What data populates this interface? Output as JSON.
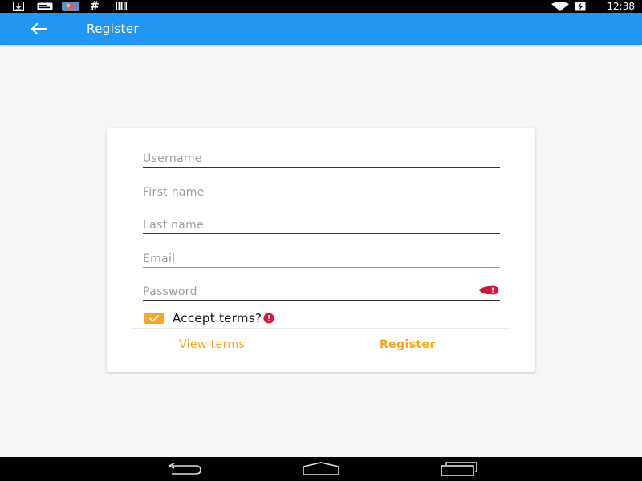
{
  "status_bar": {
    "time": "12:38",
    "icons": [
      "download-icon",
      "message-icon",
      "photo-icon",
      "hash-icon",
      "barcode-icon",
      "wifi-icon",
      "battery-charging-icon"
    ],
    "hash_glyph": "#"
  },
  "app_bar": {
    "title": "Register",
    "back_icon": "arrow-left-icon",
    "color": "#2196f3"
  },
  "form": {
    "username": {
      "placeholder": "Username",
      "value": ""
    },
    "first_name": {
      "placeholder": "First name",
      "value": ""
    },
    "last_name": {
      "placeholder": "Last name",
      "value": ""
    },
    "email": {
      "placeholder": "Email",
      "value": ""
    },
    "password": {
      "placeholder": "Password",
      "value": "",
      "error_icon": "error-icon"
    },
    "terms": {
      "label": "Accept terms?",
      "checked": true,
      "error_icon": "error-icon"
    }
  },
  "actions": {
    "view_terms": "View terms",
    "register": "Register"
  },
  "colors": {
    "accent": "#f5a623",
    "error": "#e0103a"
  },
  "nav_bar": {
    "icons": [
      "back-nav-icon",
      "home-nav-icon",
      "recents-nav-icon"
    ]
  }
}
